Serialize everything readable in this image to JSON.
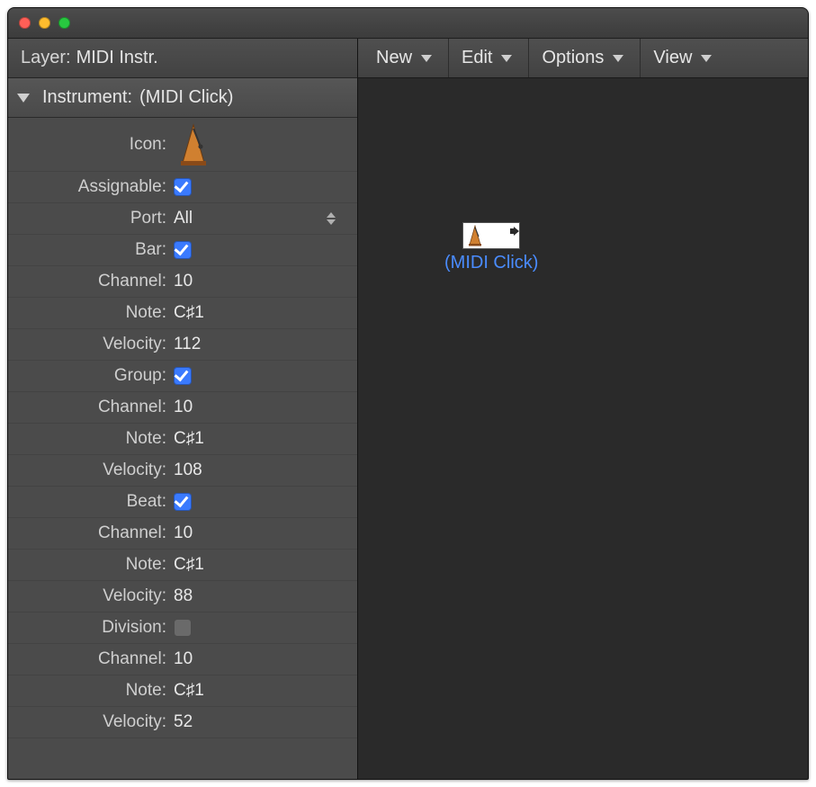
{
  "layer": {
    "label": "Layer:",
    "value": "MIDI Instr."
  },
  "instrument": {
    "label": "Instrument:",
    "value": "(MIDI Click)"
  },
  "toolbar": {
    "new": "New",
    "edit": "Edit",
    "options": "Options",
    "view": "View"
  },
  "object": {
    "label": "(MIDI Click)"
  },
  "props": {
    "icon_label": "Icon:",
    "assignable_label": "Assignable:",
    "assignable": true,
    "port_label": "Port:",
    "port_value": "All",
    "bar_label": "Bar:",
    "bar": true,
    "bar_channel_label": "Channel:",
    "bar_channel": "10",
    "bar_note_label": "Note:",
    "bar_note": "C♯1",
    "bar_velocity_label": "Velocity:",
    "bar_velocity": "112",
    "group_label": "Group:",
    "group": true,
    "group_channel_label": "Channel:",
    "group_channel": "10",
    "group_note_label": "Note:",
    "group_note": "C♯1",
    "group_velocity_label": "Velocity:",
    "group_velocity": "108",
    "beat_label": "Beat:",
    "beat": true,
    "beat_channel_label": "Channel:",
    "beat_channel": "10",
    "beat_note_label": "Note:",
    "beat_note": "C♯1",
    "beat_velocity_label": "Velocity:",
    "beat_velocity": "88",
    "division_label": "Division:",
    "division": false,
    "division_channel_label": "Channel:",
    "division_channel": "10",
    "division_note_label": "Note:",
    "division_note": "C♯1",
    "division_velocity_label": "Velocity:",
    "division_velocity": "52"
  }
}
